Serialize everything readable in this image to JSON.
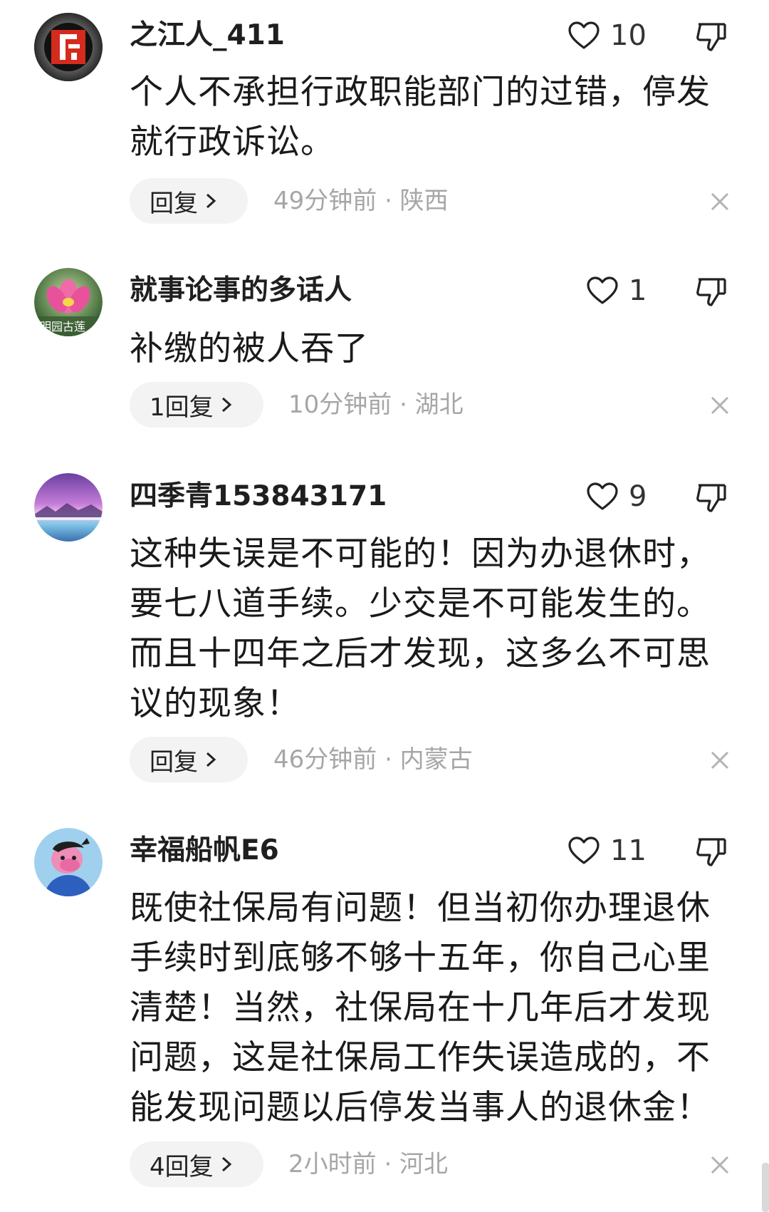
{
  "comments": [
    {
      "username": "之江人_411",
      "likes": "10",
      "text": "个人不承担行政职能部门的过错，停发就行政诉讼。",
      "reply_label": "回复",
      "meta": "49分钟前 · 陕西"
    },
    {
      "username": "就事论事的多话人",
      "likes": "1",
      "text": "补缴的被人吞了",
      "reply_label": "1回复",
      "meta": "10分钟前 · 湖北",
      "avatar_text": "明园古莲"
    },
    {
      "username": "四季青153843171",
      "likes": "9",
      "text": "这种失误是不可能的！因为办退休时，要七八道手续。少交是不可能发生的。而且十四年之后才发现，这多么不可思议的现象！",
      "reply_label": "回复",
      "meta": "46分钟前 · 内蒙古"
    },
    {
      "username": "幸福船帆E6",
      "likes": "11",
      "text": "既使社保局有问题！但当初你办理退休手续时到底够不够十五年，你自己心里清楚！当然，社保局在十几年后才发现问题，这是社保局工作失误造成的，不能发现问题以后停发当事人的退休金！",
      "reply_label": "4回复",
      "meta": "2小时前 · 河北"
    }
  ],
  "icons": {
    "like": "heart-outline-icon",
    "dislike": "thumbs-down-icon",
    "chevron": "chevron-right-icon",
    "close": "close-icon"
  },
  "colors": {
    "text": "#1a1a1a",
    "meta": "#a6a6a6",
    "pill_bg": "#f3f3f3"
  }
}
